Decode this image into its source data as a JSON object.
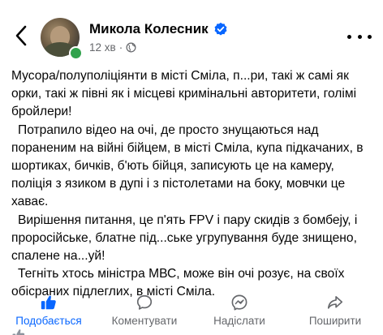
{
  "header": {
    "author_name": "Микола Колесник",
    "time": "12 хв",
    "separator": "·"
  },
  "post": {
    "paragraphs": [
      "Мусора/полуполіціянти в місті Сміла, п...ри, такі ж самі як орки, такі ж півні як і місцеві кримінальні авторитети, голімі бройлери!",
      "Потрапило відео на очі, де просто знущаються над пораненим на війні бійцем, в місті Сміла, купа підкачаних, в шортиках, бичків, б'ють бійця, записують це на камеру, поліція з язиком в дупі і з пістолетами на боку, мовчки це хаває.",
      "Вирішення питання, це п'ять FPV і пару скидів з бомбеjу, і проросійське, блатне під...ське угрупування буде знищено, спалене на...уй!",
      "Тегніть хтось міністра МВС, може він очі розує, на своїх обісраних підлеглих, в місті Сміла."
    ]
  },
  "actions": {
    "like": "Подобається",
    "comment": "Коментувати",
    "send": "Надіслати",
    "share": "Поширити"
  },
  "colors": {
    "like_active": "#0866ff",
    "secondary_text": "#65676b",
    "verified_badge": "#0866ff",
    "online_dot": "#31a24c"
  },
  "icons": {
    "back": "chevron-left-icon",
    "verified": "verified-badge-icon",
    "audience": "globe-icon",
    "more": "more-horizontal-icon",
    "like": "thumbs-up-icon",
    "comment": "comment-bubble-icon",
    "send": "messenger-icon",
    "share": "share-arrow-icon"
  }
}
